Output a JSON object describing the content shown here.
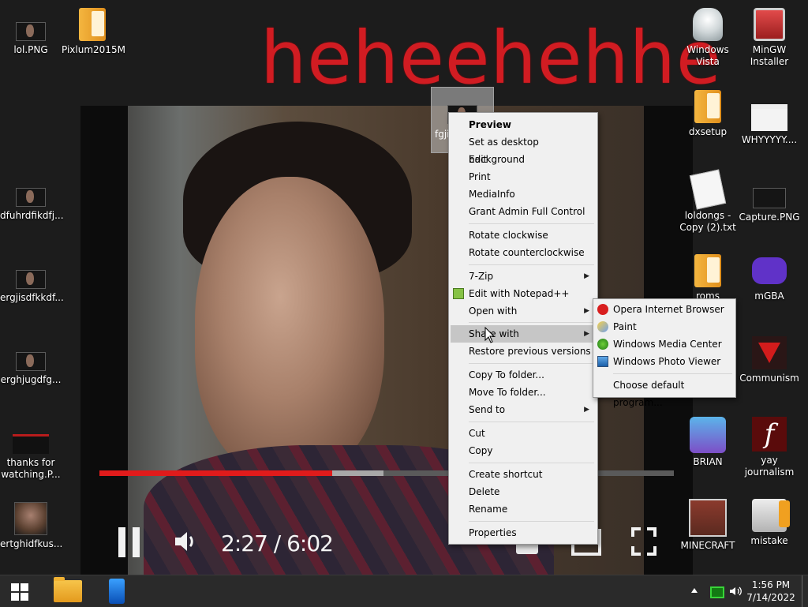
{
  "wallpaper": {
    "text": "heheehehhe"
  },
  "video": {
    "time": "2:27 / 6:02",
    "progress_fraction": 0.405,
    "buffered_fraction": 0.495
  },
  "drag_ghost": {
    "label": "fgji"
  },
  "desktop_icons_left": [
    {
      "label": "lol.PNG"
    },
    {
      "label": "Pixlum2015M"
    },
    {
      "label": "dfuhrdfikdfj..."
    },
    {
      "label": "ergjisdfkkdf..."
    },
    {
      "label": "erghjugdfg..."
    },
    {
      "label": "thanks for watching.P..."
    },
    {
      "label": "ertghidfkus..."
    }
  ],
  "desktop_icons_right": [
    {
      "label": "Windows Vista"
    },
    {
      "label": "MinGW Installer"
    },
    {
      "label": "dxsetup"
    },
    {
      "label": "WHYYYYY...."
    },
    {
      "label": "loldongs - Copy (2).txt"
    },
    {
      "label": "Capture.PNG"
    },
    {
      "label": "roms"
    },
    {
      "label": "mGBA"
    },
    {
      "label": "Communism"
    },
    {
      "label": "BRIAN"
    },
    {
      "label": "yay journalism"
    },
    {
      "label": "MINECRAFT"
    },
    {
      "label": "mistake"
    }
  ],
  "context_menu": {
    "items": [
      {
        "label": "Preview"
      },
      {
        "label": "Set as desktop background"
      },
      {
        "label": "Edit"
      },
      {
        "label": "Print"
      },
      {
        "label": "MediaInfo"
      },
      {
        "label": "Grant Admin Full Control"
      },
      {
        "label": "Rotate clockwise"
      },
      {
        "label": "Rotate counterclockwise"
      },
      {
        "label": "7-Zip"
      },
      {
        "label": "Edit with Notepad++"
      },
      {
        "label": "Open with"
      },
      {
        "label": "Share with"
      },
      {
        "label": "Restore previous versions"
      },
      {
        "label": "Copy To folder..."
      },
      {
        "label": "Move To folder..."
      },
      {
        "label": "Send to"
      },
      {
        "label": "Cut"
      },
      {
        "label": "Copy"
      },
      {
        "label": "Create shortcut"
      },
      {
        "label": "Delete"
      },
      {
        "label": "Rename"
      },
      {
        "label": "Properties"
      }
    ]
  },
  "open_with_submenu": {
    "items": [
      {
        "label": "Opera Internet Browser",
        "icon": "opera-icon"
      },
      {
        "label": "Paint",
        "icon": "paint-icon"
      },
      {
        "label": "Windows Media Center",
        "icon": "media-center-icon"
      },
      {
        "label": "Windows Photo Viewer",
        "icon": "photo-viewer-icon"
      },
      {
        "label": "Choose default program..."
      }
    ]
  },
  "taskbar": {
    "clock_time": "1:56 PM",
    "clock_date": "7/14/2022"
  },
  "colors": {
    "wallpaper_text": "#d11c22",
    "progress": "#e11b1b",
    "menu_bg": "#f0f0f0",
    "menu_highlight": "#c6c6c6"
  }
}
